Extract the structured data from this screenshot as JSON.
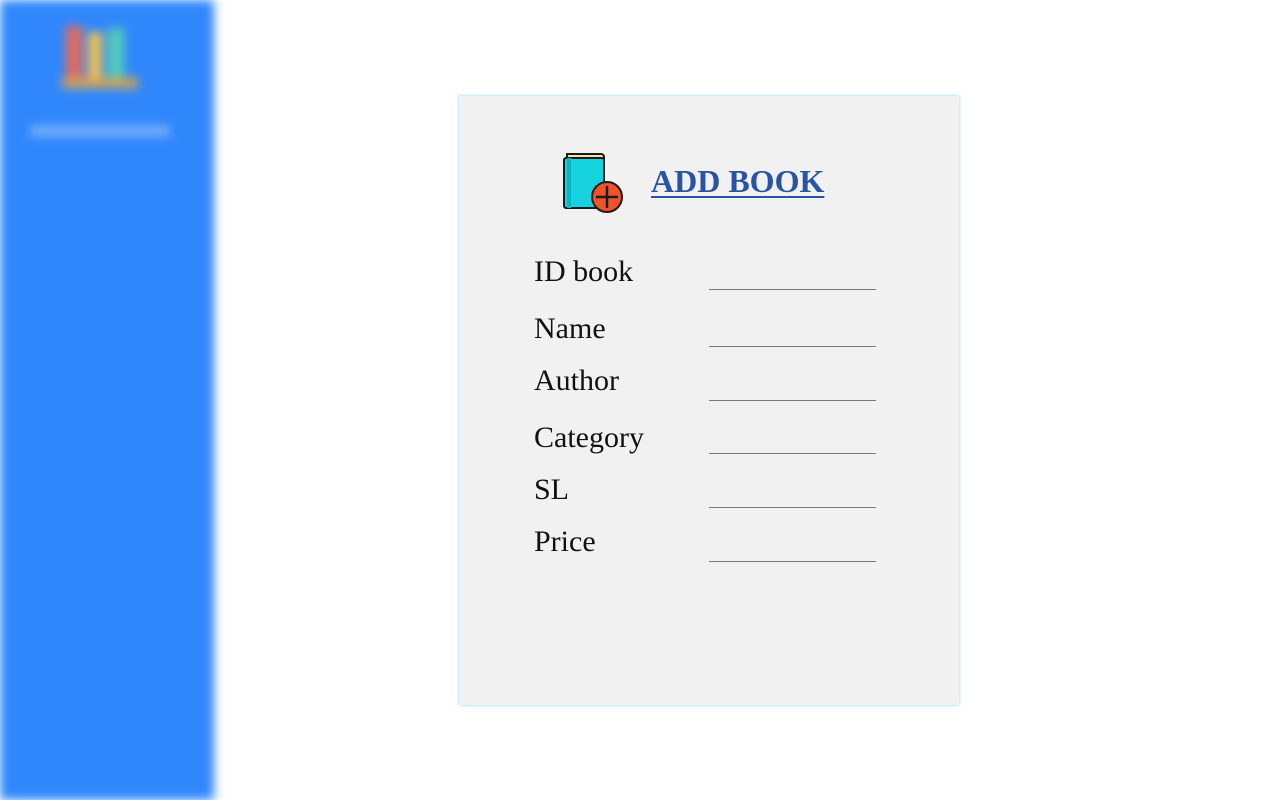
{
  "sidebar": {
    "logo_icon": "books-logo-icon"
  },
  "form": {
    "icon": "add-book-icon",
    "title": "ADD BOOK",
    "fields": [
      {
        "label": "ID book",
        "value": ""
      },
      {
        "label": "Name",
        "value": ""
      },
      {
        "label": "Author",
        "value": ""
      },
      {
        "label": "Category",
        "value": ""
      },
      {
        "label": "SL",
        "value": ""
      },
      {
        "label": "Price",
        "value": ""
      }
    ]
  },
  "colors": {
    "sidebar_bg": "#2f87fb",
    "card_bg": "#f1f1f1",
    "title": "#2853a6",
    "book_cover": "#16d3df",
    "plus_badge": "#f0522a"
  }
}
